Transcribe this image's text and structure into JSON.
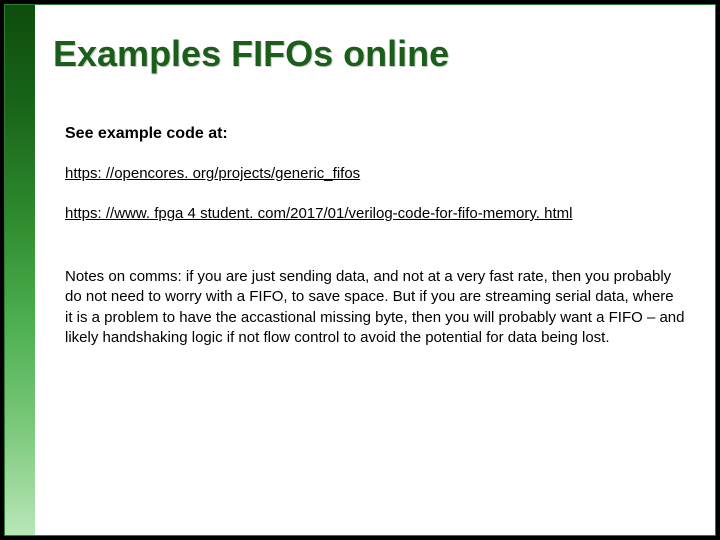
{
  "slide": {
    "title": "Examples FIFOs online",
    "subtitle": "See example code at:",
    "link1": "https: //opencores. org/projects/generic_fifos",
    "link2": "https: //www. fpga 4 student. com/2017/01/verilog-code-for-fifo-memory. html",
    "notes": "Notes on comms: if you are just sending data, and not at a very fast rate, then you probably do not need to worry with a FIFO, to save space. But if you are streaming serial data, where it is a problem to have the accastional missing byte, then you will probably want a FIFO – and likely handshaking logic if not flow control to avoid the potential for data being lost."
  }
}
